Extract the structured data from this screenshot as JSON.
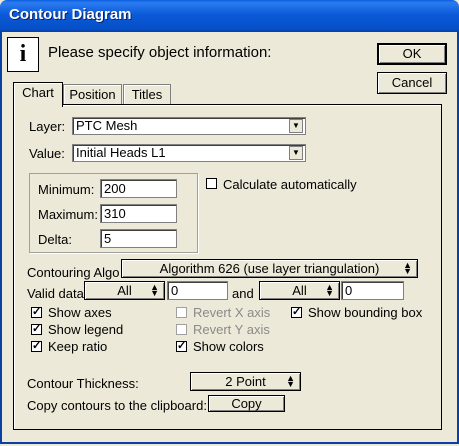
{
  "window": {
    "title": "Contour Diagram"
  },
  "header": {
    "icon": "info-icon",
    "icon_glyph": "i",
    "prompt": "Please specify object information:"
  },
  "buttons": {
    "ok": "OK",
    "cancel": "Cancel",
    "copy": "Copy"
  },
  "tabs": [
    {
      "label": "Chart",
      "active": true
    },
    {
      "label": "Position",
      "active": false
    },
    {
      "label": "Titles",
      "active": false
    }
  ],
  "chart": {
    "layer_label": "Layer:",
    "layer_value": "PTC Mesh",
    "value_label": "Value:",
    "value_value": "Initial Heads L1",
    "minimum_label": "Minimum:",
    "minimum_value": "200",
    "maximum_label": "Maximum:",
    "maximum_value": "310",
    "delta_label": "Delta:",
    "delta_value": "5",
    "calc_auto_label": "Calculate automatically",
    "calc_auto_checked": false,
    "algo_label": "Contouring Algo",
    "algo_value": "Algorithm 626 (use layer triangulation)",
    "valid_label": "Valid data",
    "valid_op1": "All",
    "valid_val1": "0",
    "and_label": "and",
    "valid_op2": "All",
    "valid_val2": "0",
    "checkboxes": {
      "show_axes": {
        "label": "Show axes",
        "checked": true,
        "enabled": true
      },
      "show_legend": {
        "label": "Show legend",
        "checked": true,
        "enabled": true
      },
      "keep_ratio": {
        "label": "Keep ratio",
        "checked": true,
        "enabled": true
      },
      "revert_x": {
        "label": "Revert X axis",
        "checked": false,
        "enabled": false
      },
      "revert_y": {
        "label": "Revert Y axis",
        "checked": false,
        "enabled": false
      },
      "show_colors": {
        "label": "Show colors",
        "checked": true,
        "enabled": true
      },
      "show_bbox": {
        "label": "Show bounding box",
        "checked": true,
        "enabled": true
      }
    },
    "thickness_label": "Contour Thickness:",
    "thickness_value": "2 Point",
    "copy_label": "Copy contours to the clipboard:"
  }
}
